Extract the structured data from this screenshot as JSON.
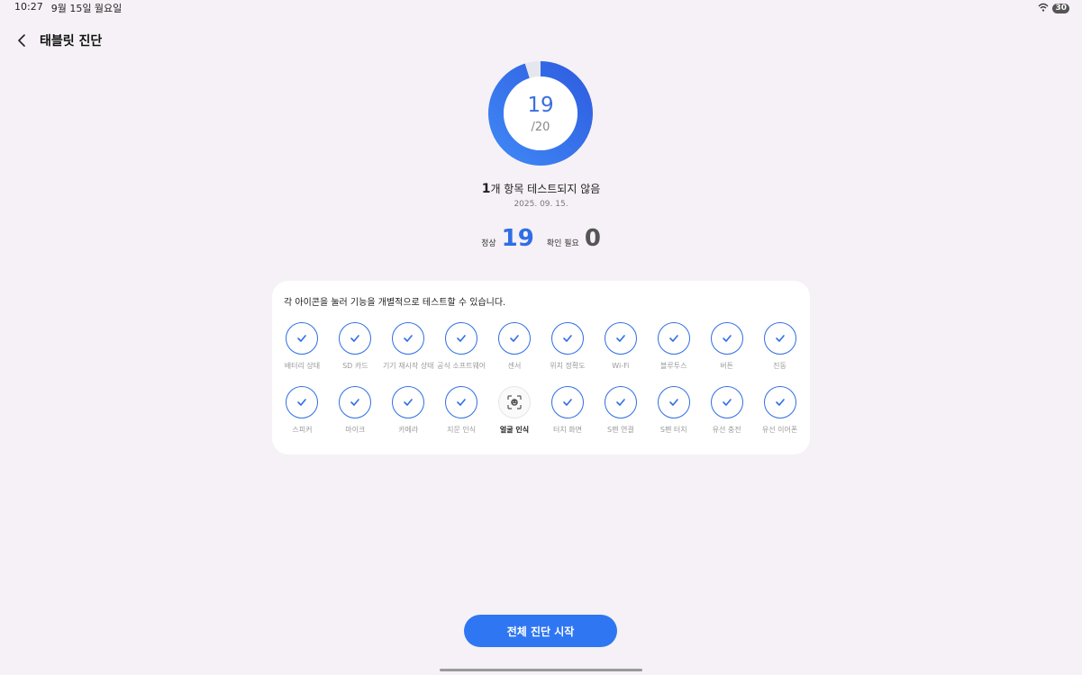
{
  "status_bar": {
    "time": "10:27",
    "date": "9월 15일 월요일",
    "battery": "30"
  },
  "header": {
    "title": "태블릿 진단"
  },
  "gauge": {
    "value": "19",
    "total": "/20",
    "fraction": 0.95,
    "accent": "#2f6ee5"
  },
  "summary": {
    "count": "1",
    "text": "개 항목 테스트되지 않음",
    "date": "2025. 09. 15."
  },
  "counts": {
    "normal_label": "정상",
    "normal_value": "19",
    "check_label": "확인 필요",
    "check_value": "0"
  },
  "card": {
    "description": "각 아이콘을 눌러 기능을 개별적으로 테스트할 수 있습니다.",
    "items": [
      {
        "label": "배터리 상태",
        "status": "pass"
      },
      {
        "label": "SD 카드",
        "status": "pass"
      },
      {
        "label": "기기 재시작 상태",
        "status": "pass"
      },
      {
        "label": "공식 소프트웨어",
        "status": "pass"
      },
      {
        "label": "센서",
        "status": "pass"
      },
      {
        "label": "위치 정확도",
        "status": "pass"
      },
      {
        "label": "Wi-Fi",
        "status": "pass"
      },
      {
        "label": "블루투스",
        "status": "pass"
      },
      {
        "label": "버튼",
        "status": "pass"
      },
      {
        "label": "진동",
        "status": "pass"
      },
      {
        "label": "스피커",
        "status": "pass"
      },
      {
        "label": "마이크",
        "status": "pass"
      },
      {
        "label": "카메라",
        "status": "pass"
      },
      {
        "label": "지문 인식",
        "status": "pass"
      },
      {
        "label": "얼굴 인식",
        "status": "untested"
      },
      {
        "label": "터치 화면",
        "status": "pass"
      },
      {
        "label": "S펜 연결",
        "status": "pass"
      },
      {
        "label": "S펜 터치",
        "status": "pass"
      },
      {
        "label": "유선 충전",
        "status": "pass"
      },
      {
        "label": "유선 이어폰",
        "status": "pass"
      }
    ]
  },
  "actions": {
    "start_label": "전체 진단 시작"
  }
}
